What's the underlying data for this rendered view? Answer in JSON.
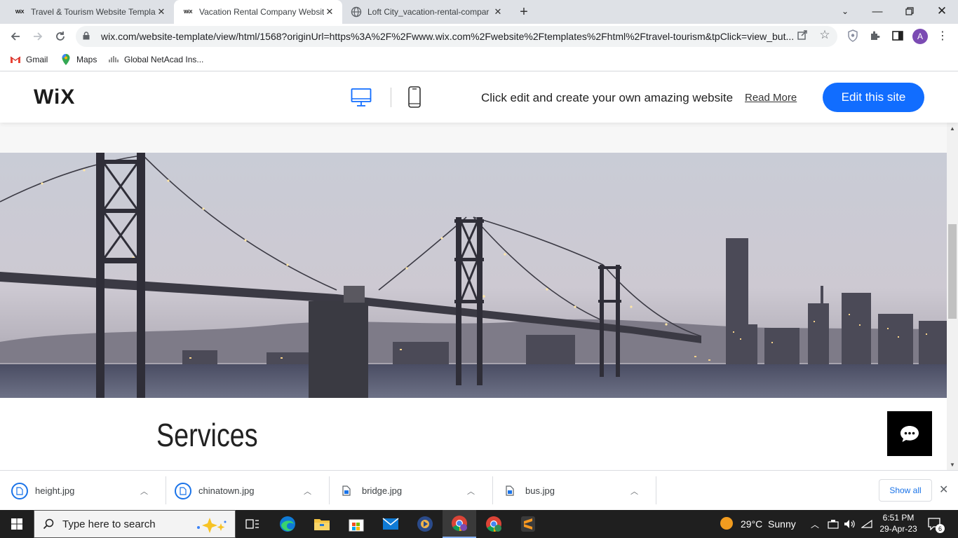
{
  "browser": {
    "tabs": [
      {
        "favicon": "WiX",
        "title": "Travel & Tourism Website Templa"
      },
      {
        "favicon": "WiX",
        "title": "Vacation Rental Company Websit"
      },
      {
        "favicon": "globe",
        "title": "Loft City_vacation-rental-compar"
      }
    ],
    "new_tab": "+",
    "url": "wix.com/website-template/view/html/1568?originUrl=https%3A%2F%2Fwww.wix.com%2Fwebsite%2Ftemplates%2Fhtml%2Ftravel-tourism&tpClick=view_but...",
    "avatar_letter": "A",
    "bookmarks": [
      {
        "label": "Gmail",
        "icon": "gmail-icon"
      },
      {
        "label": "Maps",
        "icon": "maps-icon"
      },
      {
        "label": "Global NetAcad Ins...",
        "icon": "cisco-icon"
      }
    ]
  },
  "wix_bar": {
    "logo": "WiX",
    "prompt": "Click edit and create your own amazing website",
    "read_more": "Read More",
    "edit_button": "Edit this site",
    "accent": "#116dff"
  },
  "page": {
    "hero_image": "bridge-cityscape-image",
    "section_title": "Services"
  },
  "downloads": {
    "items": [
      {
        "name": "height.jpg"
      },
      {
        "name": "chinatown.jpg"
      },
      {
        "name": "bridge.jpg"
      },
      {
        "name": "bus.jpg"
      }
    ],
    "show_all": "Show all"
  },
  "taskbar": {
    "search_placeholder": "Type here to search",
    "weather": "29°C  Sunny",
    "time": "6:51 PM",
    "date": "29-Apr-23",
    "notifications": "6"
  }
}
